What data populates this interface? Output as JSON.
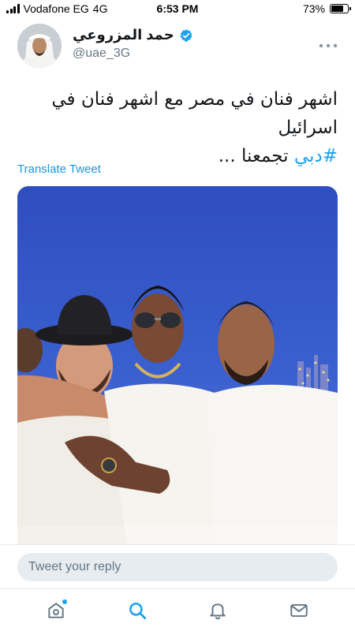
{
  "status_bar": {
    "carrier": "Vodafone EG",
    "network": "4G",
    "time": "6:53 PM",
    "battery": "73%",
    "battery_level": 0.73
  },
  "tweet": {
    "author_name": "حمد المزروعي",
    "handle": "@uae_3G",
    "text_line1": "اشهر فنان في مصر مع اشهر فنان في اسرائيل",
    "hashtag": "#دبي",
    "text_line2_rest": " تجمعنا ...",
    "translate_label": "Translate Tweet"
  },
  "reply": {
    "placeholder": "Tweet your reply"
  },
  "tab_bar": {
    "items": [
      "home-icon",
      "search-icon",
      "notifications-icon",
      "messages-icon"
    ],
    "active": "search-icon"
  },
  "colors": {
    "accent": "#1da1f2",
    "link": "#1b95e0",
    "secondary_text": "#657786"
  }
}
